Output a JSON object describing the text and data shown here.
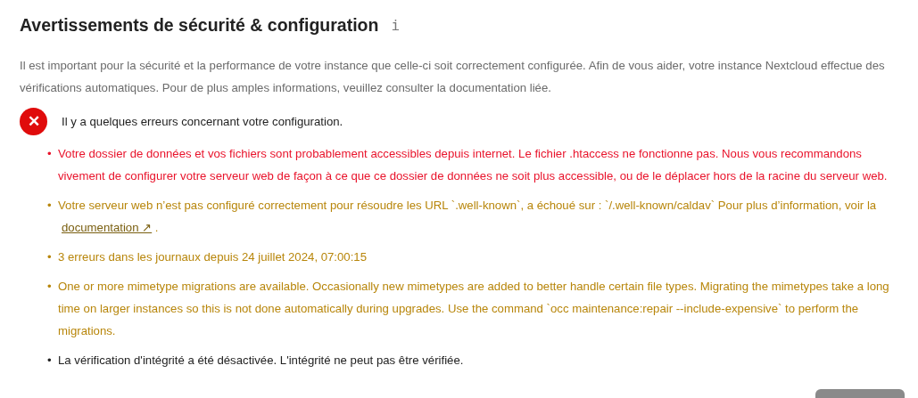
{
  "heading": {
    "title": "Avertissements de sécurité & configuration",
    "info_icon": "i"
  },
  "intro": "Il est important pour la sécurité et la performance de votre instance que celle-ci soit correctement configurée. Afin de vous aider, votre instance Nextcloud effectue des vérifications automatiques. Pour de plus amples informations, veuillez consulter la documentation liée.",
  "status": {
    "kind": "error",
    "icon": "✕",
    "message": "Il y a quelques erreurs concernant votre configuration."
  },
  "issues": [
    {
      "kind": "error",
      "bullet": "•",
      "text": "Votre dossier de données et vos fichiers sont probablement accessibles depuis internet. Le fichier .htaccess ne fonctionne pas. Nous vous recommandons vivement de configurer votre serveur web de façon à ce que ce dossier de données ne soit plus accessible, ou de le déplacer hors de la racine du serveur web."
    },
    {
      "kind": "warning",
      "bullet": "•",
      "text": "Votre serveur web n’est pas configuré correctement pour résoudre les URL `.well-known`, a échoué sur : `/.well-known/caldav` Pour plus d’information, voir la",
      "link": "documentation ↗",
      "text_after": "."
    },
    {
      "kind": "warning",
      "bullet": "•",
      "text": "3 erreurs dans les journaux depuis 24 juillet 2024, 07:00:15"
    },
    {
      "kind": "warning",
      "bullet": "•",
      "text": "One or more mimetype migrations are available. Occasionally new mimetypes are added to better handle certain file types. Migrating the mimetypes take a long time on larger instances so this is not done automatically during upgrades. Use the command `occ maintenance:repair --include-expensive` to perform the migrations."
    },
    {
      "kind": "info",
      "bullet": "•",
      "text": "La vérification d'intégrité a été désactivée. L'intégrité ne peut pas être vérifiée."
    }
  ]
}
